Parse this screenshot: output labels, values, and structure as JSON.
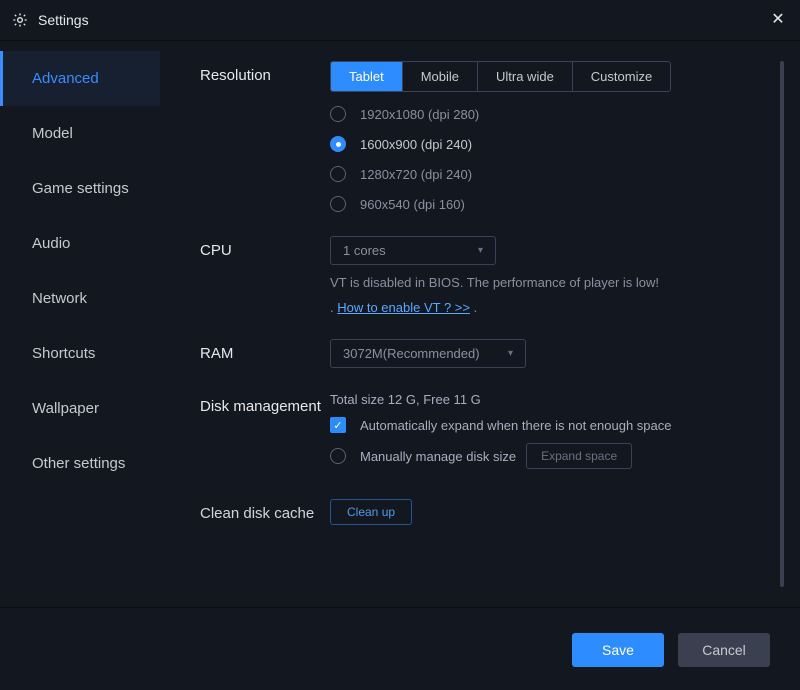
{
  "window": {
    "title": "Settings"
  },
  "sidebar": {
    "items": [
      {
        "label": "Advanced",
        "active": true
      },
      {
        "label": "Model",
        "active": false
      },
      {
        "label": "Game settings",
        "active": false
      },
      {
        "label": "Audio",
        "active": false
      },
      {
        "label": "Network",
        "active": false
      },
      {
        "label": "Shortcuts",
        "active": false
      },
      {
        "label": "Wallpaper",
        "active": false
      },
      {
        "label": "Other settings",
        "active": false
      }
    ]
  },
  "resolution": {
    "label": "Resolution",
    "tabs": [
      {
        "label": "Tablet",
        "active": true
      },
      {
        "label": "Mobile",
        "active": false
      },
      {
        "label": "Ultra wide",
        "active": false
      },
      {
        "label": "Customize",
        "active": false
      }
    ],
    "options": [
      {
        "label": "1920x1080  (dpi 280)",
        "selected": false
      },
      {
        "label": "1600x900  (dpi 240)",
        "selected": true
      },
      {
        "label": "1280x720  (dpi 240)",
        "selected": false
      },
      {
        "label": "960x540  (dpi 160)",
        "selected": false
      }
    ]
  },
  "cpu": {
    "label": "CPU",
    "value": "1 cores",
    "warning": "VT is disabled in BIOS. The performance of player is low!",
    "link": "How to enable VT ? >>"
  },
  "ram": {
    "label": "RAM",
    "value": "3072M(Recommended)"
  },
  "disk": {
    "label": "Disk management",
    "info": "Total size 12 G,  Free 11 G",
    "auto_label": "Automatically expand when there is not enough space",
    "manual_label": "Manually manage disk size",
    "expand_btn": "Expand space"
  },
  "clean": {
    "label": "Clean disk cache",
    "btn": "Clean up"
  },
  "footer": {
    "save": "Save",
    "cancel": "Cancel"
  }
}
